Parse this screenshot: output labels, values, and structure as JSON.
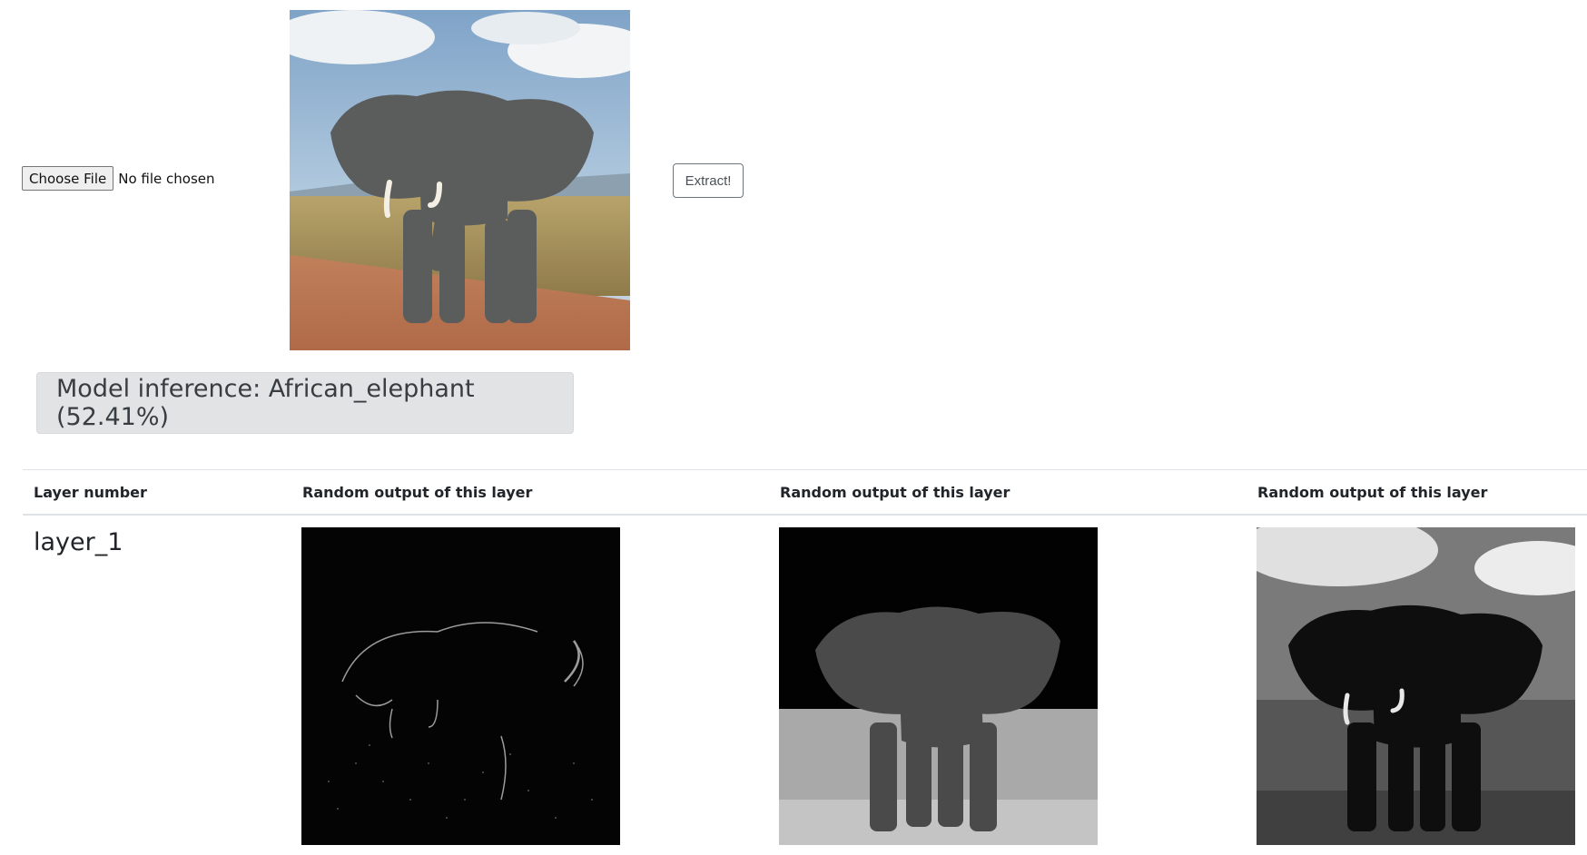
{
  "upload": {
    "choose_button": "Choose File",
    "status": "No file chosen"
  },
  "extract_button": "Extract!",
  "inference": {
    "text": "Model inference: African_elephant (52.41%)"
  },
  "table": {
    "headers": [
      "Layer number",
      "Random output of this layer",
      "Random output of this layer",
      "Random output of this layer"
    ],
    "rows": [
      {
        "layer": "layer_1"
      }
    ]
  },
  "colors": {
    "inference_bg": "#e2e3e5",
    "inference_text": "#383d41",
    "table_border": "#dee2e6"
  }
}
